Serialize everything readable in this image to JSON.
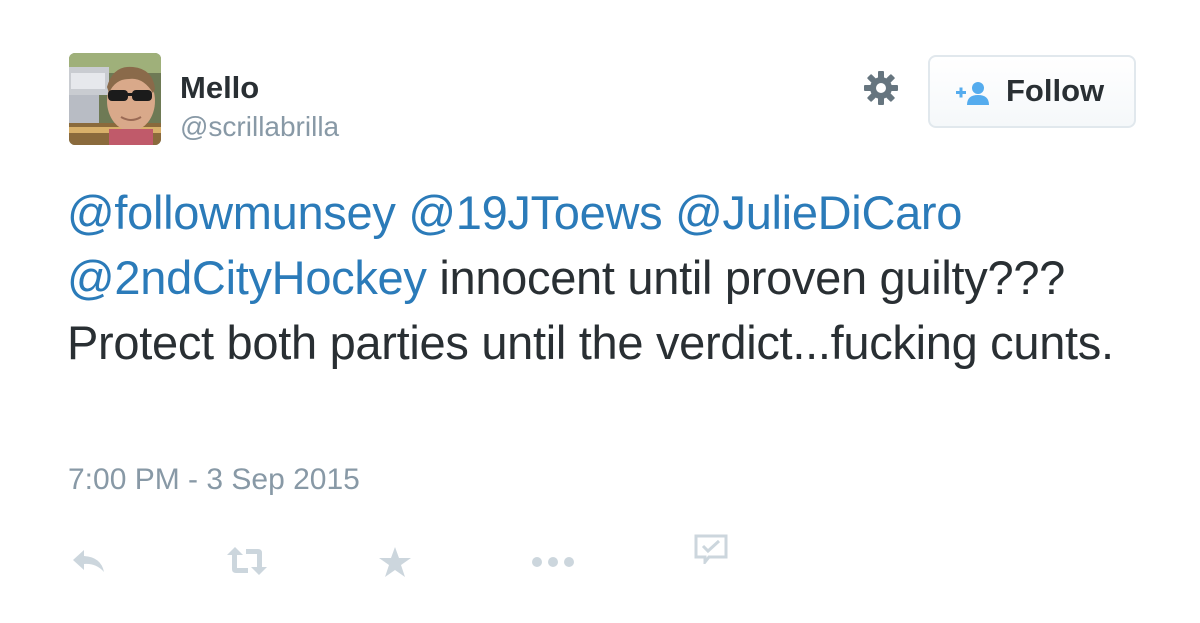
{
  "user": {
    "name": "Mello",
    "handle": "@scrillabrilla"
  },
  "header": {
    "follow_label": "Follow",
    "settings_icon": "gear-icon",
    "follow_icon": "add-user-icon"
  },
  "tweet": {
    "mentions": [
      "@followmunsey",
      "@19JToews",
      "@JulieDiCaro",
      "@2ndCityHockey"
    ],
    "text": "innocent until proven guilty??? Protect both parties until the verdict...fucking cunts.",
    "timestamp": "7:00 PM - 3 Sep 2015"
  },
  "actions": {
    "icons": [
      "reply-icon",
      "retweet-icon",
      "favorite-icon",
      "more-icon",
      "analytics-icon"
    ]
  },
  "colors": {
    "link": "#2b7bb9",
    "text": "#292f33",
    "muted": "#8899a6",
    "icon": "#ccd6dd"
  }
}
